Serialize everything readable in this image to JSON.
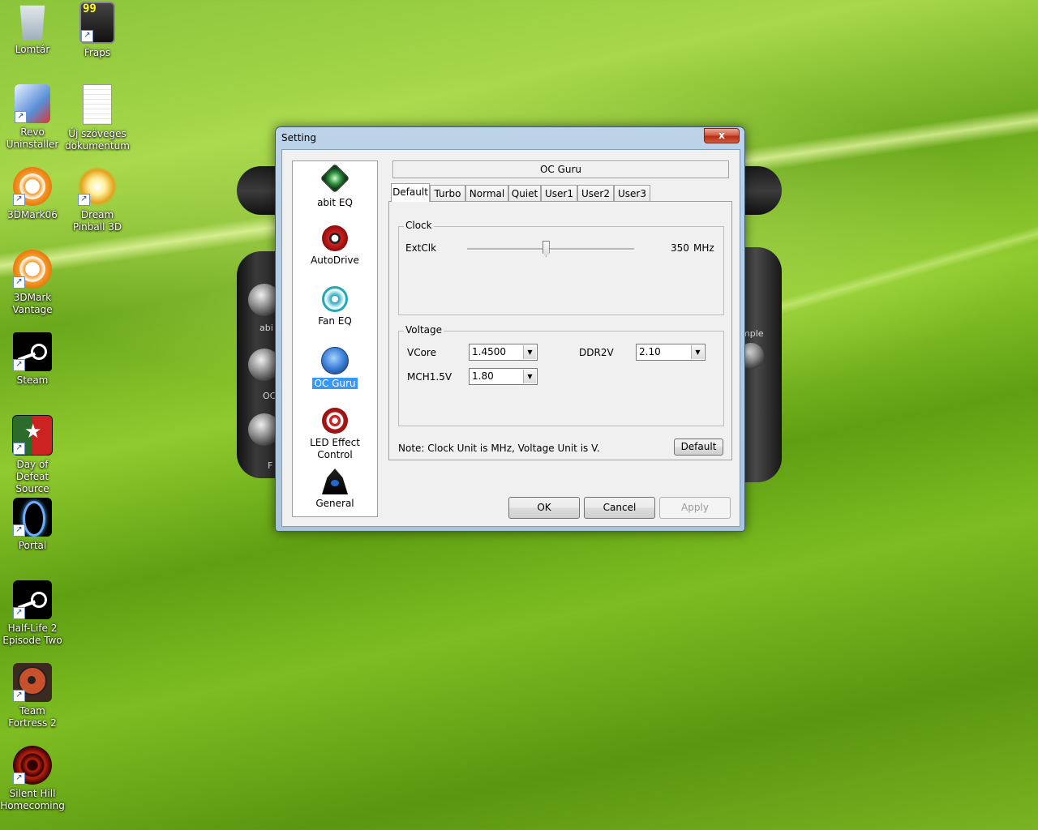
{
  "desktop": {
    "icons": [
      {
        "label": "Lomtár"
      },
      {
        "label": "Fraps"
      },
      {
        "label": "Revo Uninstaller"
      },
      {
        "label": "Új szöveges dokumentum"
      },
      {
        "label": "3DMark06"
      },
      {
        "label": "Dream Pinball 3D"
      },
      {
        "label": "3DMark Vantage"
      },
      {
        "label": "Steam"
      },
      {
        "label": "Day of Defeat Source"
      },
      {
        "label": "Portal"
      },
      {
        "label": "Half-Life 2 Episode Two"
      },
      {
        "label": "Team Fortress 2"
      },
      {
        "label": "Silent Hill Homecoming"
      }
    ],
    "fraps_counter": "99",
    "skin_text": {
      "abit": "abi",
      "oc": "OC",
      "f": "F",
      "mple": "mple"
    }
  },
  "window": {
    "title": "Setting",
    "close_glyph": "x",
    "nav": [
      {
        "label": "abit EQ",
        "icon": "abit-eq-icon"
      },
      {
        "label": "AutoDrive",
        "icon": "autodrive-icon"
      },
      {
        "label": "Fan EQ",
        "icon": "fan-eq-icon"
      },
      {
        "label": "OC Guru",
        "icon": "oc-guru-icon",
        "selected": true
      },
      {
        "label": "LED Effect Control",
        "icon": "led-effect-icon"
      },
      {
        "label": "General",
        "icon": "general-icon"
      }
    ],
    "panel_title": "OC Guru",
    "tabs": [
      "Default",
      "Turbo",
      "Normal",
      "Quiet",
      "User1",
      "User2",
      "User3"
    ],
    "active_tab": "Default",
    "clock": {
      "group_label": "Clock",
      "label": "ExtClk",
      "value": "350",
      "unit": "MHz",
      "slider_fraction": 0.47
    },
    "voltage": {
      "group_label": "Voltage",
      "vcore_label": "VCore",
      "vcore_value": "1.4500",
      "ddr2v_label": "DDR2V",
      "ddr2v_value": "2.10",
      "mch_label": "MCH1.5V",
      "mch_value": "1.80"
    },
    "note": "Note: Clock Unit is MHz, Voltage Unit is V.",
    "default_button": "Default",
    "ok_button": "OK",
    "cancel_button": "Cancel",
    "apply_button": "Apply"
  },
  "colors": {
    "selection": "#3399ff",
    "window_frame": "#a9c4dd",
    "close_button": "#c8402a"
  }
}
